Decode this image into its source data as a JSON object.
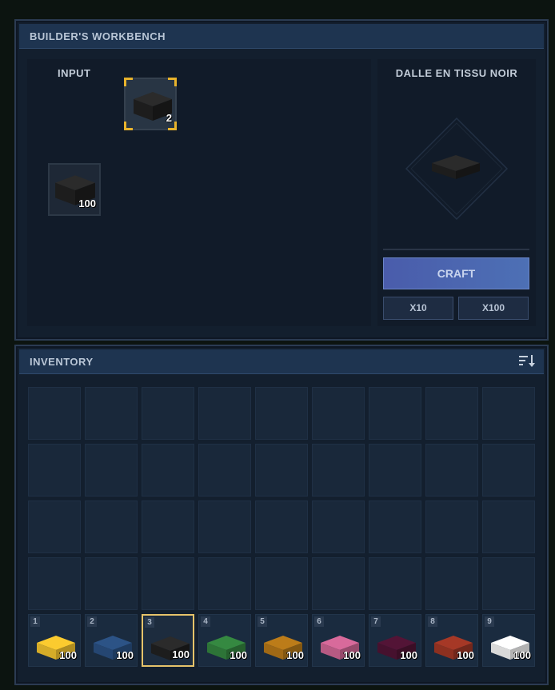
{
  "workbench": {
    "title": "BUILDER'S WORKBENCH",
    "input_label": "INPUT",
    "input_slots": [
      {
        "quantity": "2",
        "color": "#1a1a1a",
        "selected": true
      },
      {
        "quantity": "100",
        "color": "#1a1a1a",
        "selected": false
      }
    ],
    "output_title": "DALLE EN TISSU NOIR",
    "output_color": "#1a1a1a",
    "craft_label": "CRAFT",
    "x10_label": "X10",
    "x100_label": "X100"
  },
  "inventory": {
    "title": "INVENTORY",
    "sort_icon": "sort-icon",
    "hotbar": [
      {
        "key": "1",
        "quantity": "100",
        "color": "#e0b52a"
      },
      {
        "key": "2",
        "quantity": "100",
        "color": "#274a78"
      },
      {
        "key": "3",
        "quantity": "100",
        "color": "#1a1a1a"
      },
      {
        "key": "4",
        "quantity": "100",
        "color": "#2f7a3a"
      },
      {
        "key": "5",
        "quantity": "100",
        "color": "#a86f16"
      },
      {
        "key": "6",
        "quantity": "100",
        "color": "#c15f8a"
      },
      {
        "key": "7",
        "quantity": "100",
        "color": "#4a1230"
      },
      {
        "key": "8",
        "quantity": "100",
        "color": "#943222"
      },
      {
        "key": "9",
        "quantity": "100",
        "color": "#e4e4e4"
      }
    ],
    "active_hotbar_index": 2
  }
}
